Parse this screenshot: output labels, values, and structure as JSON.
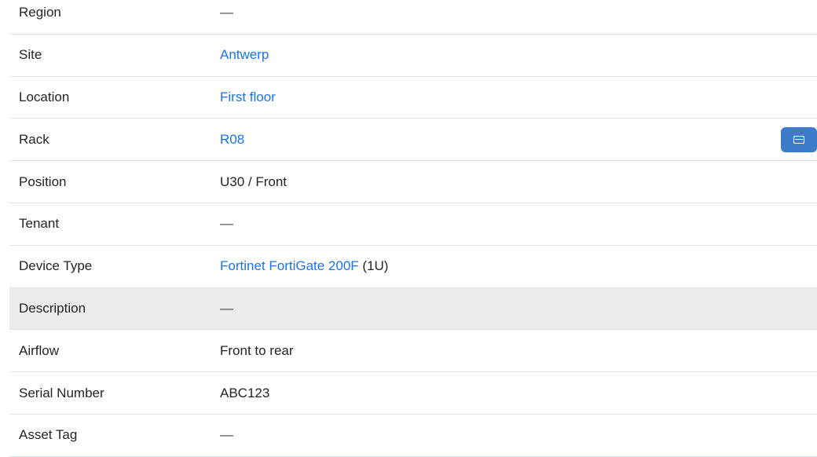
{
  "rows": [
    {
      "label": "Region",
      "value": "—",
      "link": false
    },
    {
      "label": "Site",
      "value": "Antwerp",
      "link": true
    },
    {
      "label": "Location",
      "value": "First floor",
      "link": true
    },
    {
      "label": "Rack",
      "value": "R08",
      "link": true,
      "action_icon": "rack-elevation-icon"
    },
    {
      "label": "Position",
      "value": "U30 / Front",
      "link": false
    },
    {
      "label": "Tenant",
      "value": "—",
      "link": false
    },
    {
      "label": "Device Type",
      "value": "Fortinet FortiGate 200F",
      "suffix": " (1U)",
      "link": true
    },
    {
      "label": "Description",
      "value": "—",
      "link": false,
      "highlighted": true
    },
    {
      "label": "Airflow",
      "value": "Front to rear",
      "link": false
    },
    {
      "label": "Serial Number",
      "value": "ABC123",
      "link": false
    },
    {
      "label": "Asset Tag",
      "value": "—",
      "link": false
    }
  ],
  "colors": {
    "link": "#1a73e8",
    "button": "#3d7cc9",
    "highlight_row": "#ececec"
  }
}
